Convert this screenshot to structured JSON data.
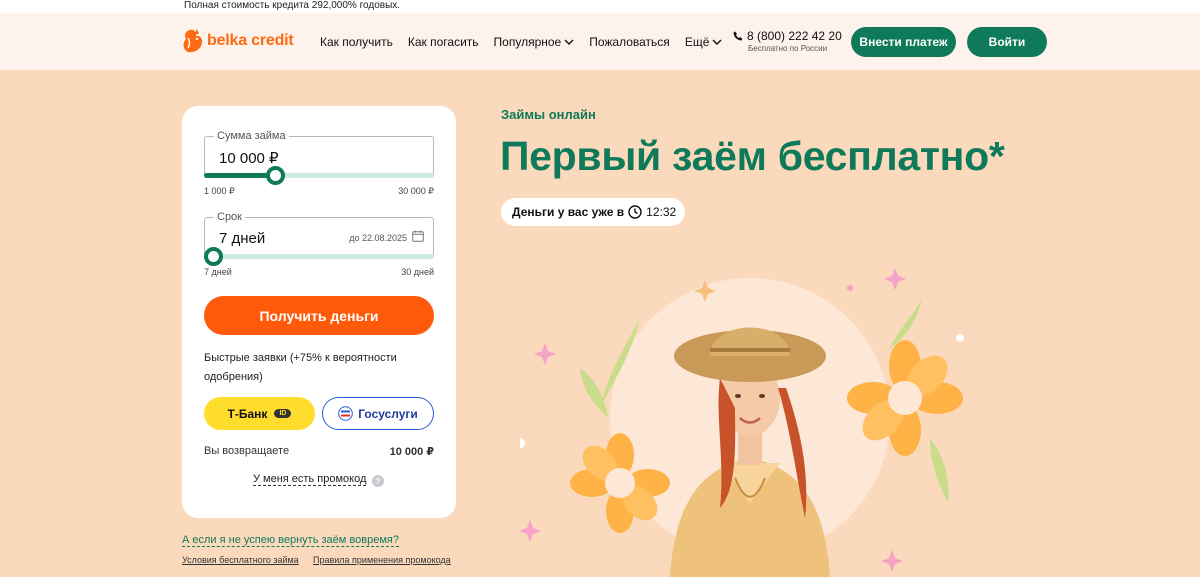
{
  "topline": "Полная стоимость кредита 292,000% годовых.",
  "logo": "belka credit",
  "nav": [
    "Как получить",
    "Как погасить",
    "Популярное",
    "Пожаловаться",
    "Ещё"
  ],
  "phone": {
    "number": "8 (800) 222 42 20",
    "note": "Бесплатно по России"
  },
  "buttons": {
    "pay": "Внести платеж",
    "login": "Войти"
  },
  "calculator": {
    "amount": {
      "label": "Сумма займа",
      "value": "10 000 ₽",
      "min": "1 000 ₽",
      "max": "30 000 ₽",
      "level": 0.31
    },
    "term": {
      "label": "Срок",
      "value": "7 дней",
      "until": "до 22.08.2025",
      "min": "7 дней",
      "max": "30 дней",
      "level": 0
    },
    "get_button": "Получить деньги",
    "fast_note": "Быстрые заявки (+75% к вероятности одобрения)",
    "tbank": "Т-Банк",
    "tbank_id": "ID",
    "gosuslugi": "Госуслуги",
    "return_label": "Вы возвращаете",
    "return_value": "10 000 ₽",
    "promo": "У меня есть промокод",
    "promo_q": "?"
  },
  "links": {
    "late": "А если я не успею вернуть заём вовремя?",
    "conditions": "Условия бесплатного займа",
    "promo_rules": "Правила применения промокода"
  },
  "hero": {
    "subtitle": "Займы онлайн",
    "title": "Первый заём бесплатно*",
    "money_label": "Деньги у вас уже в",
    "money_time": "12:32"
  },
  "colors": {
    "brand_green": "#0f7a59",
    "brand_orange": "#ff5a0a",
    "background": "#fbd9bd",
    "tbank_yellow": "#ffdd2d"
  }
}
